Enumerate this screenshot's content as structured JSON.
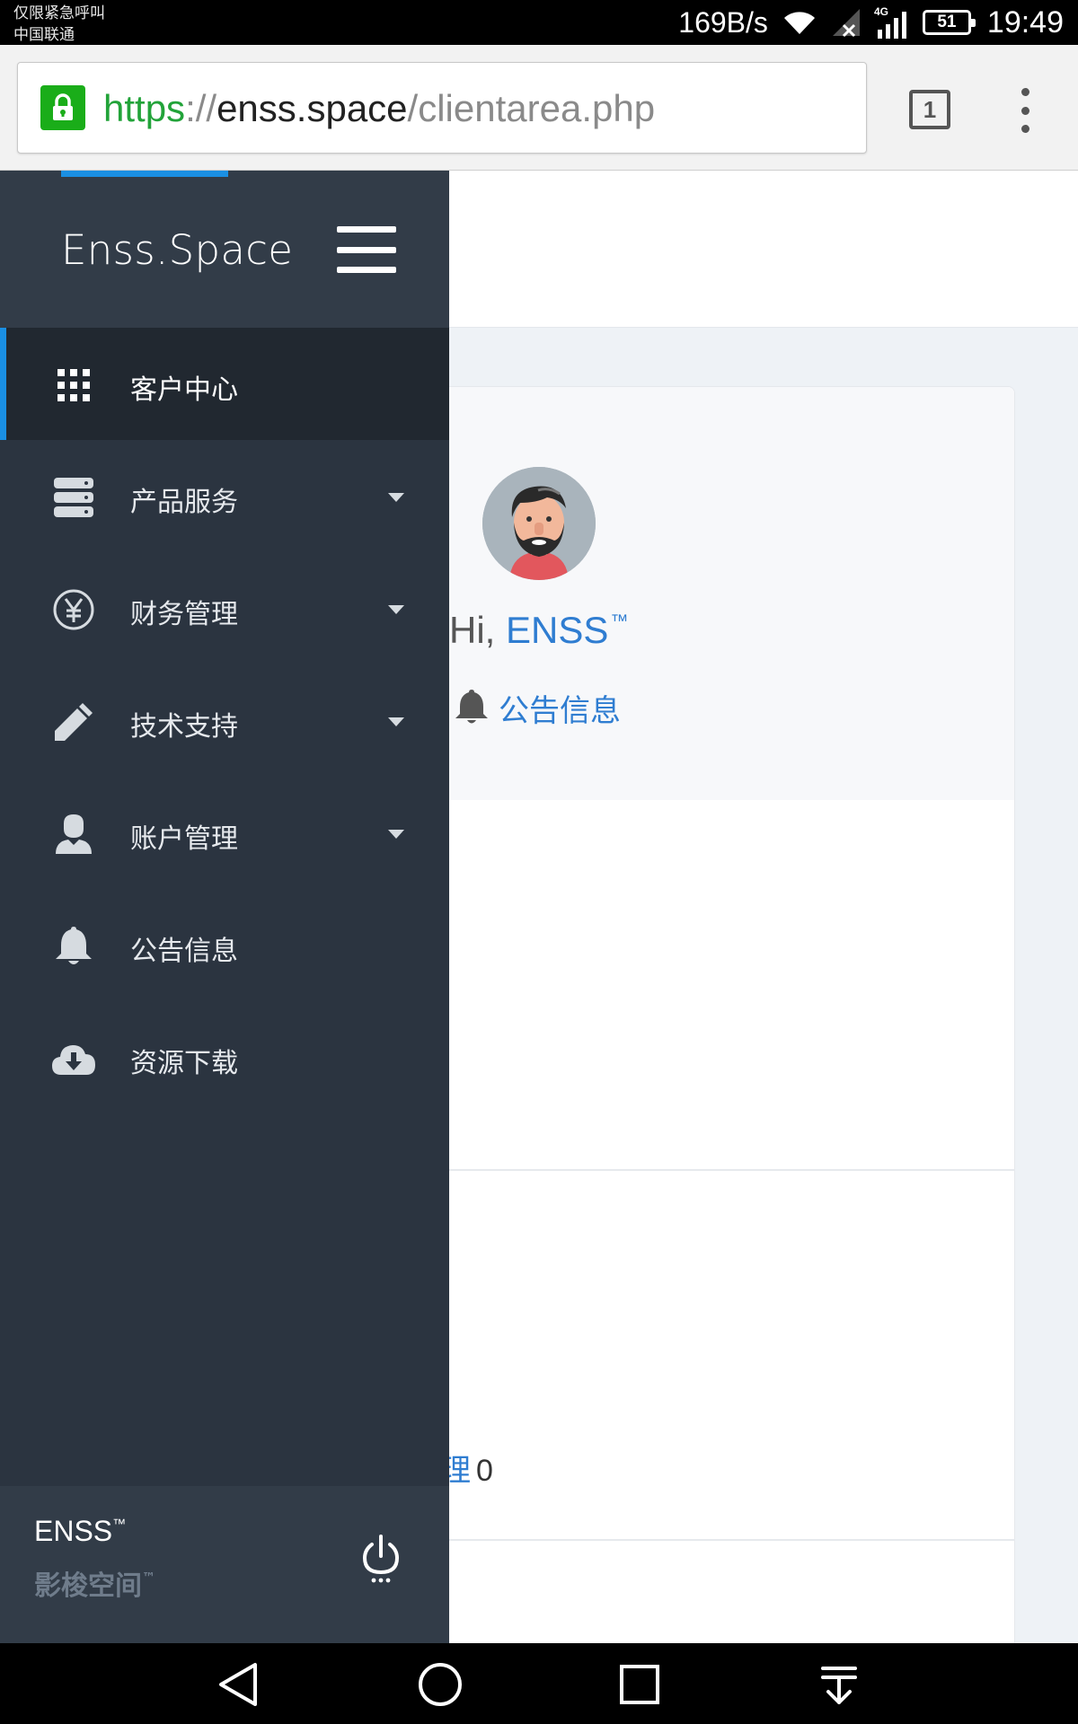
{
  "status_bar": {
    "carrier_line1": "仅限紧急呼叫",
    "carrier_line2": "中国联通",
    "net_speed": "169B/s",
    "battery": "51",
    "time": "19:49",
    "icons": [
      "wifi-icon",
      "signal-no-sim-icon",
      "signal-4g-icon",
      "battery-icon"
    ]
  },
  "browser": {
    "url_scheme": "https",
    "url_sep": "://",
    "url_host": "enss.space",
    "url_path": "/clientarea.php",
    "tab_count": "1"
  },
  "sidebar": {
    "brand": "Enss.Space",
    "items": [
      {
        "label": "客户中心",
        "icon": "grid-icon",
        "active": true,
        "has_dropdown": false
      },
      {
        "label": "产品服务",
        "icon": "server-icon",
        "active": false,
        "has_dropdown": true
      },
      {
        "label": "财务管理",
        "icon": "yen-icon",
        "active": false,
        "has_dropdown": true
      },
      {
        "label": "技术支持",
        "icon": "pencil-icon",
        "active": false,
        "has_dropdown": true
      },
      {
        "label": "账户管理",
        "icon": "user-icon",
        "active": false,
        "has_dropdown": true
      },
      {
        "label": "公告信息",
        "icon": "bell-icon",
        "active": false,
        "has_dropdown": false
      },
      {
        "label": "资源下载",
        "icon": "cloud-download-icon",
        "active": false,
        "has_dropdown": false
      }
    ],
    "footer": {
      "name": "ENSS",
      "name_tm": "™",
      "subtitle": "影梭空间",
      "subtitle_tm": "™"
    }
  },
  "main": {
    "greeting_prefix": "Hi, ",
    "greeting_name": "ENSS",
    "greeting_tm": "™",
    "notice_link": "公告信息",
    "partial_label": "理",
    "partial_count": "0"
  },
  "colors": {
    "sidebar_bg": "#2b3440",
    "sidebar_header_bg": "#323c48",
    "active_item_bg": "#212830",
    "accent": "#1a8fe3",
    "link": "#2f7dd1",
    "secure_green": "#22a339"
  }
}
